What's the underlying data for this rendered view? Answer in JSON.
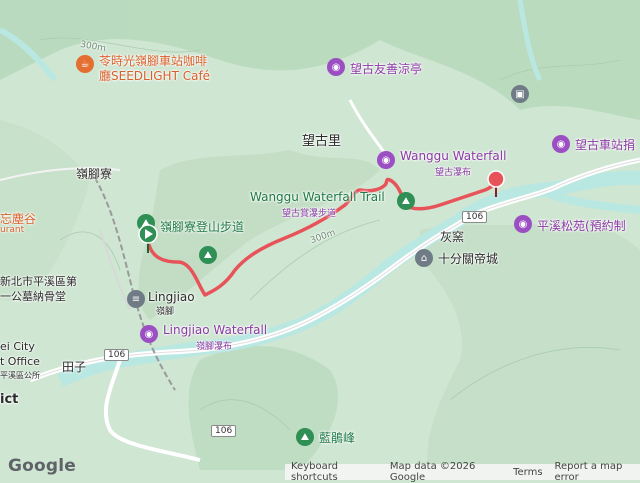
{
  "map": {
    "labels": {
      "poi_cafe": "苓時光嶺腳車站咖啡廳SEEDLIGHT Café",
      "poi_cafe_line1": "苓時光嶺腳車站咖啡",
      "poi_cafe_line2": "廳SEEDLIGHT Café",
      "wanggu_pavilion": "望古友善涼亭",
      "wanggu_station": "望古車站捐",
      "wanggu_waterfall": "Wanggu Waterfall",
      "wanggu_waterfall_zh": "望古瀑布",
      "wanggu_trail": "Wanggu Waterfall Trail",
      "wanggu_trail_zh": "望古賞瀑步道",
      "wanggu_village": "望古里",
      "lingjiao_liao": "嶺腳寮",
      "lingjiao_trail": "嶺腳寮登山步道",
      "lingjiao_station": "Lingjiao",
      "lingjiao_station_zh": "嶺腳",
      "lingjiao_waterfall": "Lingjiao Waterfall",
      "lingjiao_waterfall_zh": "嶺腳瀑布",
      "pingxi_cemetery_1": "新北市平溪區第",
      "pingxi_cemetery_2": "一公墓納骨堂",
      "pingxi_office_1": "ei City",
      "pingxi_office_2": "t Office",
      "pingxi_office_3": "平溪區公所",
      "huiyao": "灰窯",
      "temple": "十分關帝城",
      "pingxi_pine": "平溪松苑(預約制",
      "lanpeng_peak": "藍鵑峰",
      "wang_chen_gu": "忘塵谷",
      "rant": "urant",
      "tianzi": "田子",
      "ict": "ict",
      "route_106": "106",
      "elev_300m": "300m"
    },
    "colors": {
      "route": "#e8535a",
      "river": "#b9e7e2",
      "poi_purple": "#9b4fc3",
      "poi_green": "#2f8f55",
      "terrain": "#cfe6d2"
    },
    "icons": [
      "camera-icon",
      "hiking-icon",
      "train-icon",
      "temple-icon",
      "restaurant-icon",
      "bus-icon",
      "start-flag-icon",
      "end-pin-icon"
    ]
  },
  "footer": {
    "keyboard_shortcuts": "Keyboard shortcuts",
    "map_data": "Map data ©2026 Google",
    "terms": "Terms",
    "report": "Report a map error"
  },
  "branding": {
    "logo": "Google"
  }
}
